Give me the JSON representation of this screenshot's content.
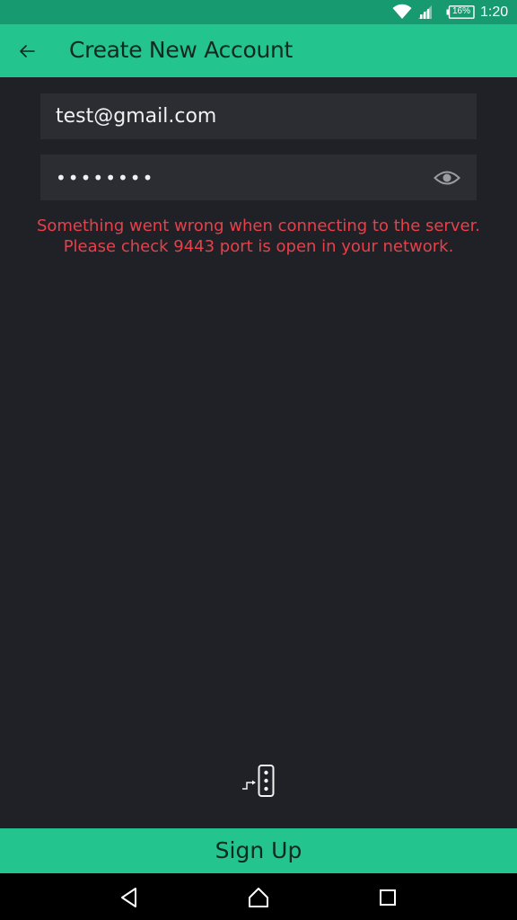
{
  "status_bar": {
    "battery_level": "16%",
    "time": "1:20"
  },
  "app_bar": {
    "title": "Create New Account"
  },
  "form": {
    "email_value": "test@gmail.com",
    "password_value": "••••••••"
  },
  "error": {
    "line1": "Something went wrong when connecting to the server.",
    "line2": "Please check 9443 port is open in your network."
  },
  "actions": {
    "signup_label": "Sign Up"
  },
  "colors": {
    "status_bar": "#179a6f",
    "accent": "#23c48e",
    "background": "#1f2126",
    "field_background": "#2b2d32",
    "error": "#e6414b"
  }
}
